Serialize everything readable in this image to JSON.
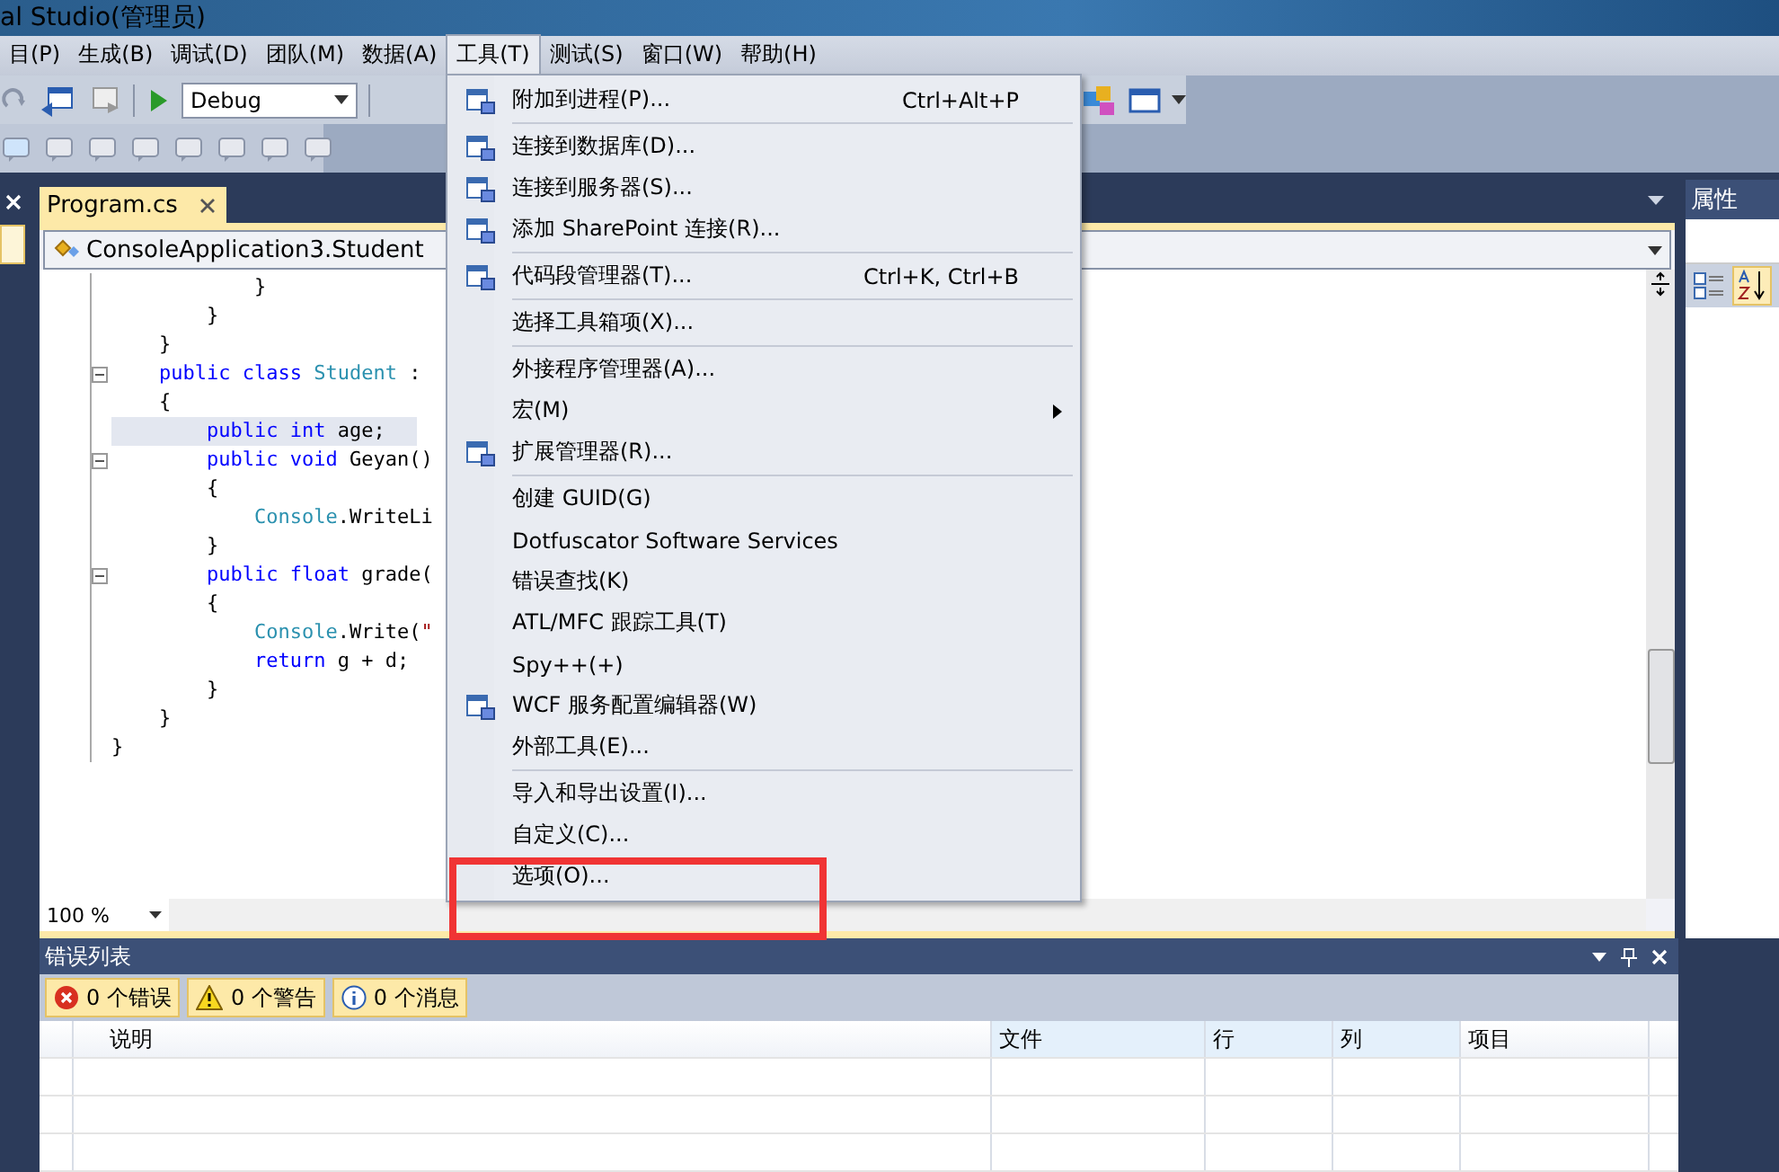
{
  "window": {
    "title": "al Studio(管理员)"
  },
  "menubar": [
    {
      "label": "目(P)",
      "selected": false
    },
    {
      "label": "生成(B)",
      "selected": false
    },
    {
      "label": "调试(D)",
      "selected": false
    },
    {
      "label": "团队(M)",
      "selected": false
    },
    {
      "label": "数据(A)",
      "selected": false
    },
    {
      "label": "工具(T)",
      "selected": true
    },
    {
      "label": "测试(S)",
      "selected": false
    },
    {
      "label": "窗口(W)",
      "selected": false
    },
    {
      "label": "帮助(H)",
      "selected": false
    }
  ],
  "toolbar": {
    "configuration": "Debug"
  },
  "tools_menu": {
    "groups": [
      [
        {
          "label": "附加到进程(P)...",
          "shortcut": "Ctrl+Alt+P",
          "has_icon": true,
          "submenu": false
        }
      ],
      [
        {
          "label": "连接到数据库(D)...",
          "has_icon": true,
          "submenu": false
        },
        {
          "label": "连接到服务器(S)...",
          "has_icon": true,
          "submenu": false
        },
        {
          "label": "添加 SharePoint 连接(R)...",
          "has_icon": true,
          "submenu": false
        }
      ],
      [
        {
          "label": "代码段管理器(T)...",
          "shortcut": "Ctrl+K, Ctrl+B",
          "has_icon": true,
          "submenu": false
        }
      ],
      [
        {
          "label": "选择工具箱项(X)...",
          "has_icon": false,
          "submenu": false
        }
      ],
      [
        {
          "label": "外接程序管理器(A)...",
          "has_icon": false,
          "submenu": false
        },
        {
          "label": "宏(M)",
          "has_icon": false,
          "submenu": true
        },
        {
          "label": "扩展管理器(R)...",
          "has_icon": true,
          "submenu": false
        }
      ],
      [
        {
          "label": "创建 GUID(G)",
          "has_icon": false,
          "submenu": false
        },
        {
          "label": "Dotfuscator Software Services",
          "has_icon": false,
          "submenu": false
        },
        {
          "label": "错误查找(K)",
          "has_icon": false,
          "submenu": false
        },
        {
          "label": "ATL/MFC 跟踪工具(T)",
          "has_icon": false,
          "submenu": false
        },
        {
          "label": "Spy++(+)",
          "has_icon": false,
          "submenu": false
        },
        {
          "label": "WCF 服务配置编辑器(W)",
          "has_icon": true,
          "submenu": false
        },
        {
          "label": "外部工具(E)...",
          "has_icon": false,
          "submenu": false
        }
      ],
      [
        {
          "label": "导入和导出设置(I)...",
          "has_icon": false,
          "submenu": false
        },
        {
          "label": "自定义(C)...",
          "has_icon": false,
          "submenu": false
        },
        {
          "label": "选项(O)...",
          "has_icon": false,
          "submenu": false
        }
      ]
    ]
  },
  "editor": {
    "tab": {
      "label": "Program.cs",
      "selected": true
    },
    "navigation": "ConsoleApplication3.Student",
    "zoom": "100 %",
    "lines": [
      {
        "fold": false,
        "highlighted": false,
        "tokens": [
          {
            "t": "            }",
            "kind": "plain"
          }
        ]
      },
      {
        "fold": false,
        "highlighted": false,
        "tokens": [
          {
            "t": "        }",
            "kind": "plain"
          }
        ]
      },
      {
        "fold": false,
        "highlighted": false,
        "tokens": [
          {
            "t": "    }",
            "kind": "plain"
          }
        ]
      },
      {
        "fold": true,
        "highlighted": false,
        "tokens": [
          {
            "t": "    public class ",
            "kind": "kw"
          },
          {
            "t": "Student",
            "kind": "type"
          },
          {
            "t": " :",
            "kind": "plain"
          }
        ]
      },
      {
        "fold": false,
        "highlighted": false,
        "tokens": [
          {
            "t": "    {",
            "kind": "plain"
          }
        ]
      },
      {
        "fold": false,
        "highlighted": true,
        "tokens": [
          {
            "t": "        public int ",
            "kind": "kw"
          },
          {
            "t": "age;",
            "kind": "plain"
          }
        ]
      },
      {
        "fold": true,
        "highlighted": false,
        "tokens": [
          {
            "t": "        public void ",
            "kind": "kw"
          },
          {
            "t": "Geyan()",
            "kind": "plain"
          }
        ]
      },
      {
        "fold": false,
        "highlighted": false,
        "tokens": [
          {
            "t": "        {",
            "kind": "plain"
          }
        ]
      },
      {
        "fold": false,
        "highlighted": false,
        "tokens": [
          {
            "t": "            Console",
            "kind": "type"
          },
          {
            "t": ".WriteLi",
            "kind": "plain"
          }
        ]
      },
      {
        "fold": false,
        "highlighted": false,
        "tokens": [
          {
            "t": "        }",
            "kind": "plain"
          }
        ]
      },
      {
        "fold": true,
        "highlighted": false,
        "tokens": [
          {
            "t": "        public float ",
            "kind": "kw"
          },
          {
            "t": "grade(",
            "kind": "plain"
          }
        ]
      },
      {
        "fold": false,
        "highlighted": false,
        "tokens": [
          {
            "t": "        {",
            "kind": "plain"
          }
        ]
      },
      {
        "fold": false,
        "highlighted": false,
        "tokens": [
          {
            "t": "            Console",
            "kind": "type"
          },
          {
            "t": ".Write(",
            "kind": "plain"
          },
          {
            "t": "\"",
            "kind": "str"
          }
        ]
      },
      {
        "fold": false,
        "highlighted": false,
        "tokens": [
          {
            "t": "            return ",
            "kind": "kw"
          },
          {
            "t": "g + d;",
            "kind": "plain"
          }
        ]
      },
      {
        "fold": false,
        "highlighted": false,
        "tokens": [
          {
            "t": "        }",
            "kind": "plain"
          }
        ]
      },
      {
        "fold": false,
        "highlighted": false,
        "tokens": [
          {
            "t": "    }",
            "kind": "plain"
          }
        ]
      },
      {
        "fold": false,
        "highlighted": false,
        "tokens": [
          {
            "t": "}",
            "kind": "plain"
          }
        ]
      }
    ]
  },
  "properties": {
    "title": "属性",
    "alphabetical": true
  },
  "error_list": {
    "title": "错误列表",
    "filters": [
      {
        "kind": "error",
        "label": "0 个错误",
        "on": true
      },
      {
        "kind": "warning",
        "label": "0 个警告",
        "on": true
      },
      {
        "kind": "info",
        "label": "0 个消息",
        "on": true
      }
    ],
    "columns": [
      "说明",
      "文件",
      "行",
      "列",
      "项目"
    ]
  }
}
